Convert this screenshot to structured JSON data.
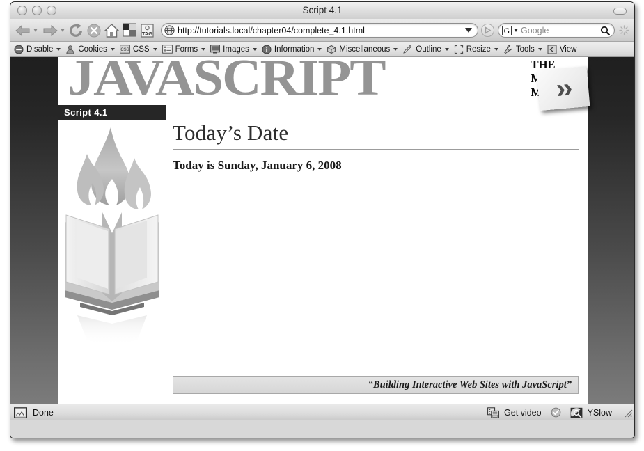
{
  "window": {
    "title": "Script 4.1",
    "traffic_lights": [
      "close-button",
      "minimize-button",
      "zoom-button"
    ],
    "minimize_pill": "collapse-button"
  },
  "navbar": {
    "back": {
      "label": "Back",
      "icon": "back-arrow-icon"
    },
    "forward": {
      "label": "Forward",
      "icon": "forward-arrow-icon"
    },
    "reload": {
      "label": "Reload",
      "icon": "reload-icon"
    },
    "stop": {
      "label": "Stop",
      "icon": "stop-icon"
    },
    "home": {
      "label": "Home",
      "icon": "home-icon"
    },
    "checker": {
      "label": "Checkerboard",
      "icon": "checkerboard-icon"
    },
    "tag": {
      "label": "TAG",
      "icon": "tag-icon"
    },
    "url": {
      "value": "http://tutorials.local/chapter04/complete_4.1.html",
      "site_icon": "globe-icon",
      "dropdown_icon": "chevron-down-icon",
      "go_icon": "go-arrow-icon"
    },
    "search": {
      "engine_logo": "G",
      "placeholder": "Google",
      "dropdown_icon": "chevron-down-icon",
      "search_icon": "magnifier-icon"
    },
    "throbber": "throbber-icon"
  },
  "devbar": {
    "items": [
      {
        "label": "Disable",
        "icon": "disable-icon"
      },
      {
        "label": "Cookies",
        "icon": "cookie-icon"
      },
      {
        "label": "CSS",
        "icon": "css-icon"
      },
      {
        "label": "Forms",
        "icon": "forms-icon"
      },
      {
        "label": "Images",
        "icon": "images-icon"
      },
      {
        "label": "Information",
        "icon": "information-icon"
      },
      {
        "label": "Miscellaneous",
        "icon": "miscellaneous-icon"
      },
      {
        "label": "Outline",
        "icon": "outline-icon"
      },
      {
        "label": "Resize",
        "icon": "resize-icon"
      },
      {
        "label": "Tools",
        "icon": "tools-icon"
      },
      {
        "label": "View",
        "icon": "view-icon"
      }
    ]
  },
  "page": {
    "banner": {
      "wordmark": "JAVASCRIPT",
      "missing_manual_line1": "THE",
      "missing_manual_line2": "MISSING",
      "missing_manual_line3": "MANUAL",
      "next_badge": "››"
    },
    "sidebar": {
      "script_label": "Script 4.1",
      "logo": "burning-book-logo"
    },
    "content": {
      "heading": "Today’s Date",
      "date_sentence": "Today is Sunday, January 6, 2008",
      "footer_quote": "“Building Interactive Web Sites with JavaScript”"
    }
  },
  "statusbar": {
    "page_icon": "page-meter-icon",
    "status": "Done",
    "get_video": {
      "label": "Get video",
      "icon": "get-video-icon"
    },
    "check": "check-circle-icon",
    "yslow": {
      "label": "YSlow",
      "icon": "yslow-icon"
    },
    "grip": "resize-grip-icon"
  },
  "colors": {
    "chrome": "#dcdcdc",
    "viewport_top": "#1f1f1f",
    "viewport_bottom": "#7b7b7b",
    "wordmark_gray": "#949494",
    "script_tag_bg": "#262626"
  }
}
